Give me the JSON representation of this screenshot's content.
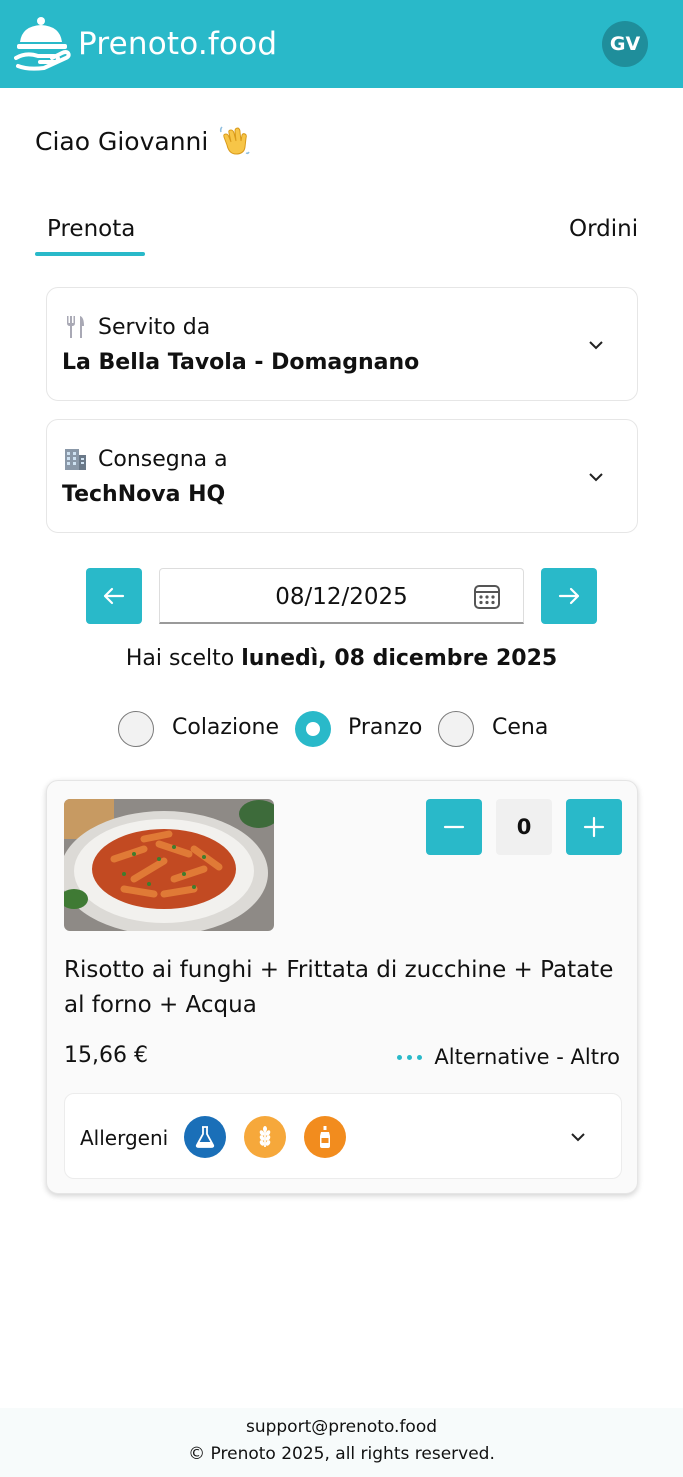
{
  "app": {
    "brand": "Prenoto.food",
    "user_initials": "GV",
    "accent_color": "#29b9c9"
  },
  "greeting": "Ciao Giovanni",
  "tabs": {
    "book_label": "Prenota",
    "orders_label": "Ordini",
    "active": "Prenota"
  },
  "served_by": {
    "label": "Servito da",
    "value": "La Bella Tavola - Domagnano",
    "icon": "fork-knife-icon"
  },
  "deliver_to": {
    "label": "Consegna a",
    "value": "TechNova HQ",
    "icon": "office-building-icon"
  },
  "date_picker": {
    "value": "08/12/2025",
    "chosen_prefix": "Hai scelto",
    "chosen_date": "lunedì, 08 dicembre 2025"
  },
  "meals": {
    "options": [
      "Colazione",
      "Pranzo",
      "Cena"
    ],
    "selected": "Pranzo"
  },
  "menu_item": {
    "name": "Risotto ai funghi + Frittata di zucchine + Patate al forno + Acqua",
    "price": "15,66 €",
    "quantity": "0",
    "alternatives_label": "Alternative - Altro",
    "allergens_label": "Allergeni",
    "allergens": [
      {
        "icon": "sulphites-flask-icon",
        "color": "#1a6fb8"
      },
      {
        "icon": "gluten-wheat-icon",
        "color": "#f6a83b"
      },
      {
        "icon": "sauce-bottle-icon",
        "color": "#f28c1e"
      }
    ]
  },
  "footer": {
    "email": "support@prenoto.food",
    "copyright": "© Prenoto 2025, all rights reserved."
  }
}
